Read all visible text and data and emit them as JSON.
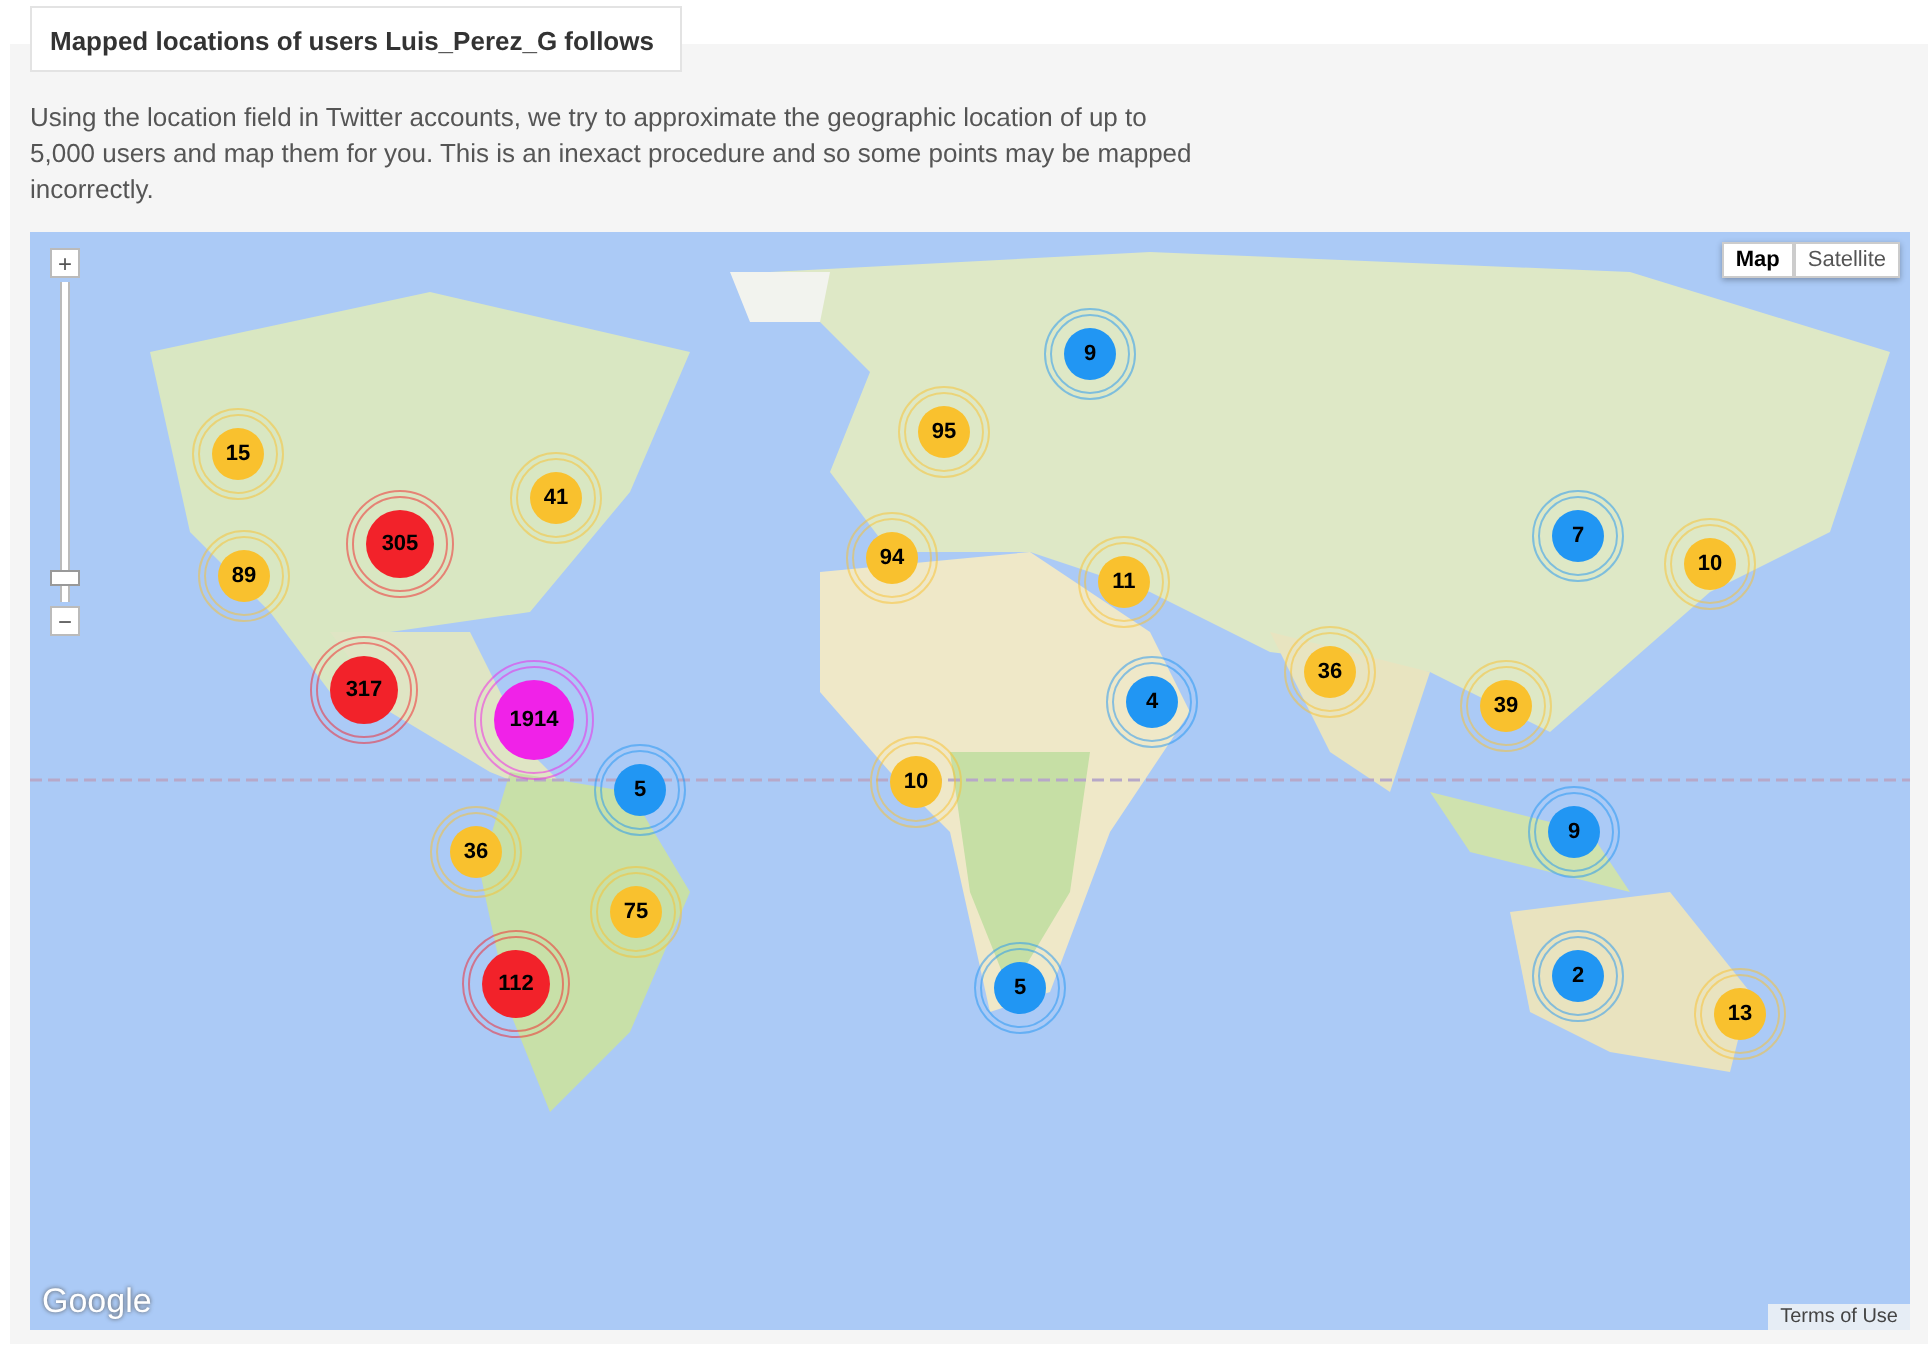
{
  "title": "Mapped locations of users Luis_Perez_G follows",
  "description": "Using the location field in Twitter accounts, we try to approximate the geographic location of up to 5,000 users and map them for you. This is an inexact procedure and so some points may be mapped incorrectly.",
  "map": {
    "zoom_controls": {
      "zoom_in": "+",
      "zoom_out": "−",
      "level": 0.05
    },
    "type_buttons": [
      {
        "label": "Map",
        "selected": true
      },
      {
        "label": "Satellite",
        "selected": false
      }
    ],
    "clusters": [
      {
        "count": "15",
        "color": "#f9c12e"
      },
      {
        "count": "305",
        "color": "#f2222a"
      },
      {
        "count": "41",
        "color": "#f9c12e"
      },
      {
        "count": "89",
        "color": "#f9c12e"
      },
      {
        "count": "317",
        "color": "#f2222a"
      },
      {
        "count": "1914",
        "color": "#f022e8"
      },
      {
        "count": "5",
        "color": "#2196f3"
      },
      {
        "count": "36",
        "color": "#f9c12e"
      },
      {
        "count": "75",
        "color": "#f9c12e"
      },
      {
        "count": "112",
        "color": "#f2222a"
      },
      {
        "count": "9",
        "color": "#2196f3"
      },
      {
        "count": "95",
        "color": "#f9c12e"
      },
      {
        "count": "94",
        "color": "#f9c12e"
      },
      {
        "count": "11",
        "color": "#f9c12e"
      },
      {
        "count": "4",
        "color": "#2196f3"
      },
      {
        "count": "10",
        "color": "#f9c12e"
      },
      {
        "count": "5",
        "color": "#2196f3"
      },
      {
        "count": "36",
        "color": "#f9c12e"
      },
      {
        "count": "39",
        "color": "#f9c12e"
      },
      {
        "count": "7",
        "color": "#2196f3"
      },
      {
        "count": "10",
        "color": "#f9c12e"
      },
      {
        "count": "9",
        "color": "#2196f3"
      },
      {
        "count": "2",
        "color": "#2196f3"
      },
      {
        "count": "13",
        "color": "#f9c12e"
      }
    ],
    "logo": "Google",
    "terms": "Terms of Use"
  }
}
